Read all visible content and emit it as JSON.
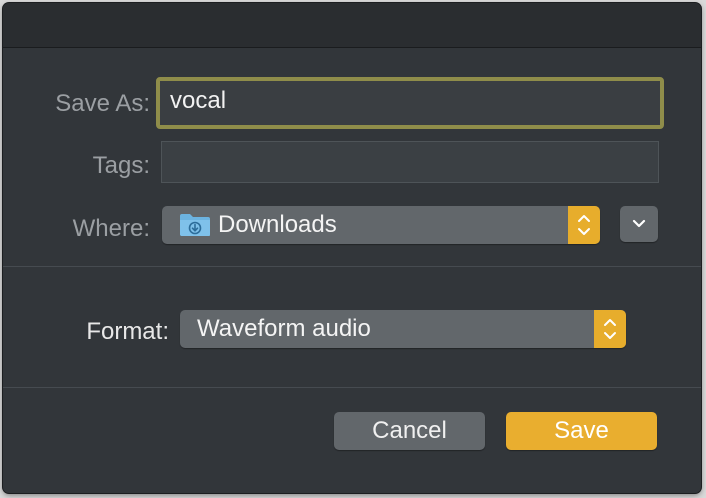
{
  "dialog": {
    "save_as_label": "Save As:",
    "save_as_value": "vocal",
    "tags_label": "Tags:",
    "tags_value": "",
    "where_label": "Where:",
    "where_value": "Downloads",
    "where_icon": "downloads-folder-icon",
    "format_label": "Format:",
    "format_value": "Waveform audio",
    "cancel_label": "Cancel",
    "save_label": "Save"
  },
  "colors": {
    "background": "#32363a",
    "accent": "#e9ae2f",
    "focus_ring": "#8f8d4a",
    "control": "#62676b",
    "folder": "#6cb3e0"
  }
}
